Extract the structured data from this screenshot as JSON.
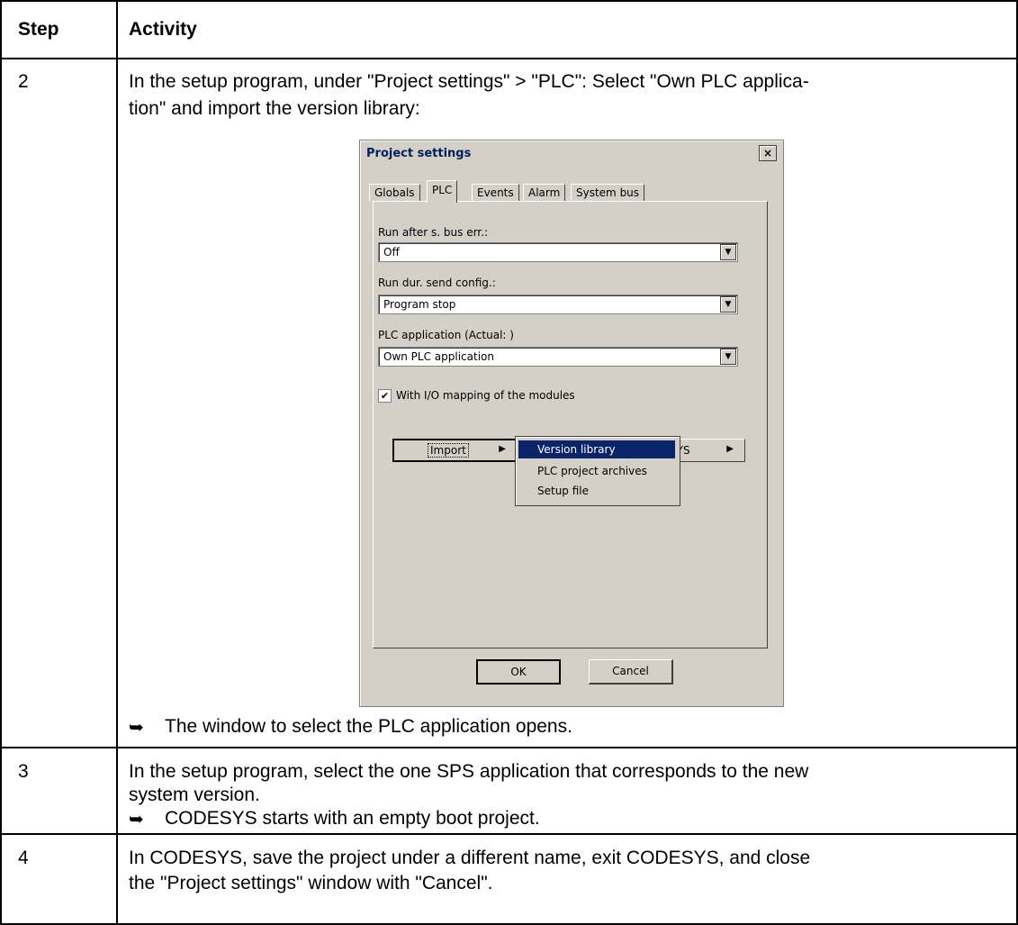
{
  "table": {
    "header": {
      "step": "Step",
      "activity": "Activity"
    },
    "rows": [
      {
        "step": "2",
        "line1": "In the setup program, under \"Project settings\" > \"PLC\": Select \"Own PLC applica-",
        "line2": "tion\" and import the version library:",
        "result": "The window to select the PLC application opens."
      },
      {
        "step": "3",
        "line1": "In the setup program, select the one SPS application that corresponds to the new",
        "line2": "system version.",
        "result": "CODESYS starts with an empty boot project."
      },
      {
        "step": "4",
        "line1": "In CODESYS, save the project under a different name, exit CODESYS, and close",
        "line2": "the \"Project settings\" window with \"Cancel\"."
      }
    ],
    "result_arrow": "➥"
  },
  "dialog": {
    "title": "Project settings",
    "close": "×",
    "tabs": [
      "Globals",
      "PLC",
      "Events",
      "Alarm",
      "System bus"
    ],
    "fields": [
      {
        "label": "Run after s. bus err.:",
        "value": "Off"
      },
      {
        "label": "Run dur. send config.:",
        "value": "Program stop"
      },
      {
        "label": "PLC application (Actual: )",
        "value": "Own PLC application"
      }
    ],
    "checkbox": {
      "label": "With I/O mapping of the modules",
      "checked_mark": "✔"
    },
    "import_button": "Import",
    "other_button_partial": "SYS",
    "menu_items": [
      "Version library",
      "PLC project archives",
      "Setup file"
    ],
    "ok": "OK",
    "cancel": "Cancel",
    "submenu_arrow": "▶",
    "dropdown_arrow": "▼"
  }
}
